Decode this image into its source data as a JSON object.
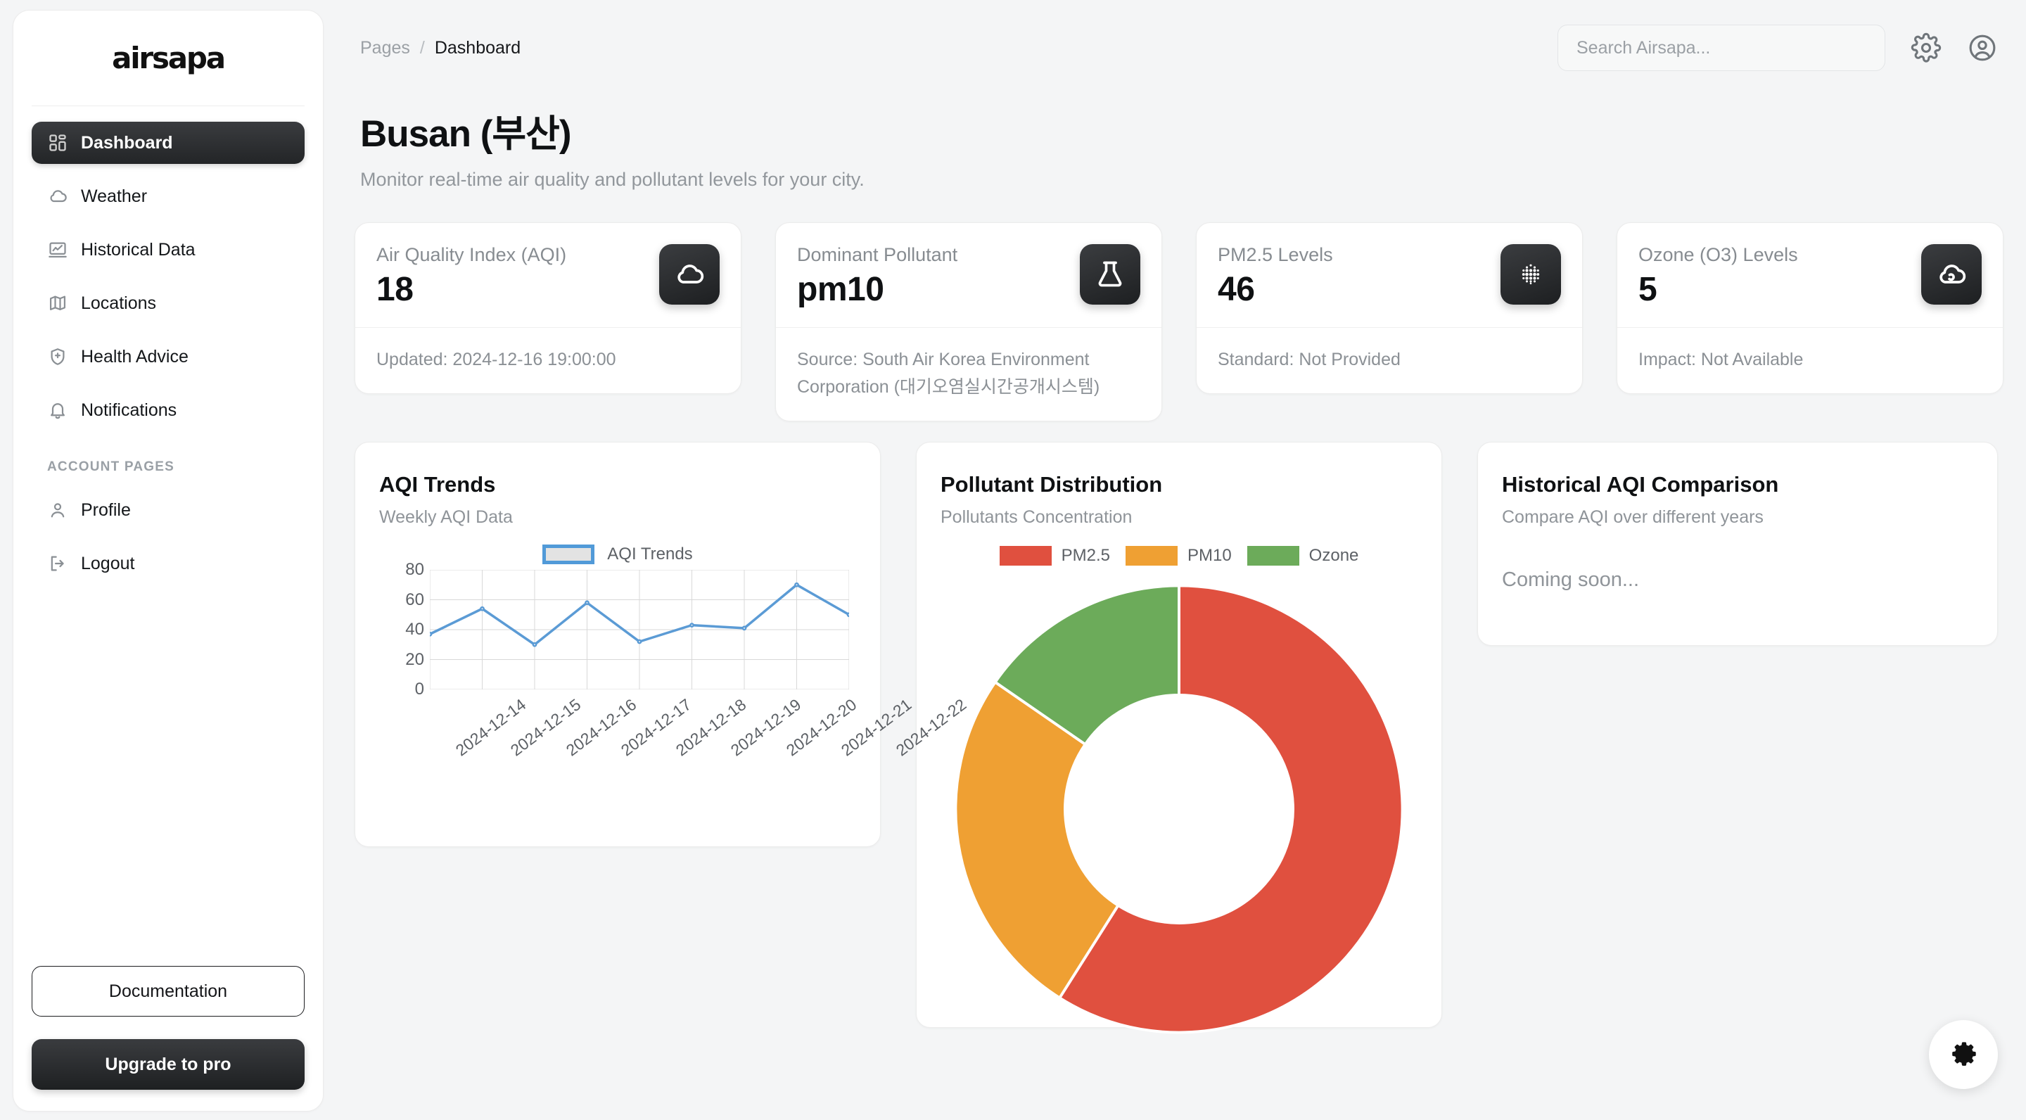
{
  "brand": {
    "name": "airsapa"
  },
  "sidebar": {
    "items": [
      {
        "label": "Dashboard",
        "icon": "grid-icon",
        "active": true
      },
      {
        "label": "Weather",
        "icon": "cloud-icon",
        "active": false
      },
      {
        "label": "Historical Data",
        "icon": "chart-line-icon",
        "active": false
      },
      {
        "label": "Locations",
        "icon": "map-icon",
        "active": false
      },
      {
        "label": "Health Advice",
        "icon": "shield-plus-icon",
        "active": false
      },
      {
        "label": "Notifications",
        "icon": "bell-icon",
        "active": false
      }
    ],
    "section_label": "ACCOUNT PAGES",
    "account_items": [
      {
        "label": "Profile",
        "icon": "user-icon"
      },
      {
        "label": "Logout",
        "icon": "logout-icon"
      }
    ],
    "documentation_label": "Documentation",
    "upgrade_label": "Upgrade to pro"
  },
  "topbar": {
    "breadcrumb_parent": "Pages",
    "breadcrumb_separator": "/",
    "breadcrumb_current": "Dashboard",
    "search_placeholder": "Search Airsapa...",
    "search_value": "",
    "settings_icon": "gear-icon",
    "account_icon": "user-circle-icon"
  },
  "page": {
    "title": "Busan (부산)",
    "subtitle": "Monitor real-time air quality and pollutant levels for your city."
  },
  "stats": [
    {
      "label": "Air Quality Index (AQI)",
      "value": "18",
      "footer": "Updated: 2024-12-16 19:00:00",
      "icon": "cloud-icon"
    },
    {
      "label": "Dominant Pollutant",
      "value": "pm10",
      "footer": "Source: South Air Korea Environment Corporation (대기오염실시간공개시스템)",
      "icon": "flask-icon"
    },
    {
      "label": "PM2.5 Levels",
      "value": "46",
      "footer": "Standard: Not Provided",
      "icon": "particles-icon"
    },
    {
      "label": "Ozone (O3) Levels",
      "value": "5",
      "footer": "Impact: Not Available",
      "icon": "cloud-ozone-icon"
    }
  ],
  "cards": {
    "trends": {
      "title": "AQI Trends",
      "subtitle": "Weekly AQI Data"
    },
    "donut": {
      "title": "Pollutant Distribution",
      "subtitle": "Pollutants Concentration"
    },
    "historical": {
      "title": "Historical AQI Comparison",
      "subtitle": "Compare AQI over different years",
      "body": "Coming soon..."
    }
  },
  "fab": {
    "icon": "gear-icon"
  },
  "colors": {
    "accent_dark": "#1e2022",
    "line_blue": "#5b9bd5",
    "pm25_red": "#e0503f",
    "pm10_orange": "#efa033",
    "ozone_green": "#6cab5a"
  },
  "chart_data": [
    {
      "type": "line",
      "title": "AQI Trends",
      "subtitle": "Weekly AQI Data",
      "legend": [
        "AQI Trends"
      ],
      "legend_position": "top",
      "grid": true,
      "xlabel": "",
      "ylabel": "",
      "ylim": [
        0,
        80
      ],
      "yticks": [
        0,
        20,
        40,
        60,
        80
      ],
      "categories": [
        "2024-12-14",
        "2024-12-15",
        "2024-12-16",
        "2024-12-17",
        "2024-12-18",
        "2024-12-19",
        "2024-12-20",
        "2024-12-21",
        "2024-12-22"
      ],
      "series": [
        {
          "name": "AQI Trends",
          "color": "#5b9bd5",
          "values": [
            37,
            54,
            30,
            58,
            32,
            43,
            41,
            70,
            50
          ]
        }
      ]
    },
    {
      "type": "pie",
      "title": "Pollutant Distribution",
      "subtitle": "Pollutants Concentration",
      "donut": true,
      "legend_position": "top",
      "labels": [
        "PM2.5",
        "PM10",
        "Ozone"
      ],
      "values": [
        46,
        20,
        12
      ],
      "percentages": [
        59,
        25,
        16
      ],
      "colors": [
        "#e0503f",
        "#efa033",
        "#6cab5a"
      ]
    }
  ]
}
